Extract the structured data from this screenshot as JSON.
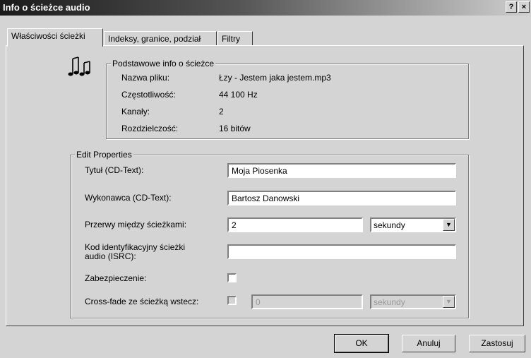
{
  "window": {
    "title": "Info o ścieżce audio",
    "help_label": "?",
    "close_label": "×"
  },
  "tabs": [
    {
      "label": "Właściwości ścieżki"
    },
    {
      "label": "Indeksy, granice, podział"
    },
    {
      "label": "Filtry"
    }
  ],
  "basic_info": {
    "title": "Podstawowe info o ścieżce",
    "rows": [
      {
        "label": "Nazwa pliku:",
        "value": "Łzy - Jestem jaka jestem.mp3"
      },
      {
        "label": "Częstotliwość:",
        "value": "44 100 Hz"
      },
      {
        "label": "Kanały:",
        "value": "2"
      },
      {
        "label": "Rozdzielczość:",
        "value": "16 bitów"
      }
    ],
    "icon": "music-notes-icon"
  },
  "edit": {
    "title": "Edit Properties",
    "title_label": "Tytuł (CD-Text):",
    "title_value": "Moja Piosenka",
    "artist_label": "Wykonawca (CD-Text):",
    "artist_value": "Bartosz Danowski",
    "gap_label": "Przerwy między ścieżkami:",
    "gap_value": "2",
    "gap_unit": "sekundy",
    "isrc_label_line1": "Kod identyfikacyjny ścieżki",
    "isrc_label_line2": "audio (ISRC):",
    "isrc_value": "",
    "protect_label": "Zabezpieczenie:",
    "crossfade_label": "Cross-fade ze ścieżką wstecz:",
    "crossfade_value": "0",
    "crossfade_unit": "sekundy"
  },
  "buttons": {
    "ok": "OK",
    "cancel": "Anuluj",
    "apply": "Zastosuj"
  }
}
